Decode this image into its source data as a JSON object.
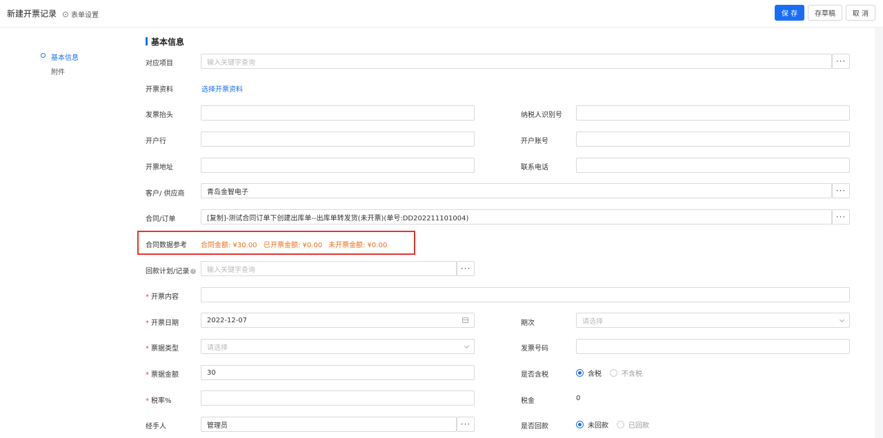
{
  "header": {
    "title": "新建开票记录",
    "form_settings": "表单设置",
    "save": "保 存",
    "draft": "存草稿",
    "cancel": "取 消"
  },
  "nav": {
    "items": [
      {
        "label": "基本信息",
        "active": true
      },
      {
        "label": "附件",
        "active": false
      }
    ]
  },
  "section": {
    "title": "基本信息"
  },
  "form": {
    "project": {
      "label": "对应项目",
      "placeholder": "输入关键字查询"
    },
    "invoice_info": {
      "label": "开票资料",
      "link": "选择开票资料"
    },
    "invoice_title": {
      "label": "发票抬头",
      "value": ""
    },
    "taxpayer_id": {
      "label": "纳税人识别号",
      "value": ""
    },
    "bank": {
      "label": "开户行",
      "value": ""
    },
    "account": {
      "label": "开户账号",
      "value": ""
    },
    "address": {
      "label": "开票地址",
      "value": ""
    },
    "phone": {
      "label": "联系电话",
      "value": ""
    },
    "customer": {
      "label": "客户/ 供应商",
      "value": "青岛金智电子"
    },
    "contract": {
      "label": "合同/订单",
      "value": "[复制]-测试合同订单下创建出库单--出库单转发货(未开票)(单号:DD202211101004)"
    },
    "contract_ref": {
      "label": "合同数据参考",
      "contract_amount": "合同金额: ¥30.00",
      "invoiced_amount": "已开票金额: ¥0.00",
      "uninvoiced_amount": "未开票金额: ¥0.00"
    },
    "payment_plan": {
      "label": "回款计划/记录",
      "placeholder": "输入关键字查询"
    },
    "content": {
      "label": "开票内容",
      "value": ""
    },
    "date": {
      "label": "开票日期",
      "value": "2022-12-07"
    },
    "period": {
      "label": "期次",
      "placeholder": "请选择"
    },
    "bill_type": {
      "label": "票据类型",
      "placeholder": "请选择"
    },
    "invoice_no": {
      "label": "发票号码",
      "value": ""
    },
    "bill_amount": {
      "label": "票据金额",
      "value": "30"
    },
    "tax_included": {
      "label": "是否含税",
      "option_on": "含税",
      "option_off": "不含税"
    },
    "tax_rate": {
      "label": "税率%",
      "value": ""
    },
    "tax": {
      "label": "税金",
      "value": "0"
    },
    "handler": {
      "label": "经手人",
      "value": "管理员"
    },
    "collected": {
      "label": "是否回款",
      "option_on": "未回款",
      "option_off": "已回款"
    }
  }
}
